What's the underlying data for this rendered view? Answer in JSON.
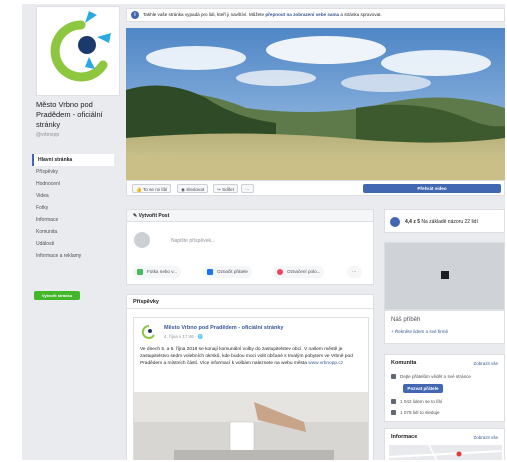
{
  "notice": {
    "text": "Takhle vaše stránka vypadá pro lidi, kteří ji navštíví. Můžete",
    "link": "přepnout na zobrazení sebe sama",
    "text_after": "a stránku spravovat.",
    "icon": "info-icon"
  },
  "sidebar": {
    "page_name": "Město Vrbno pod Pradědem - oficiální stránky",
    "handle": "@vrbnopp",
    "items": [
      {
        "label": "Hlavní stránka",
        "active": true
      },
      {
        "label": "Příspěvky"
      },
      {
        "label": "Hodnocení"
      },
      {
        "label": "Videa"
      },
      {
        "label": "Fotky"
      },
      {
        "label": "Informace"
      },
      {
        "label": "Komunita"
      },
      {
        "label": "Události"
      },
      {
        "label": "Informace a reklamy"
      }
    ],
    "create_button": "Vytvořit stránku"
  },
  "actions": {
    "like": "To se mi líbí",
    "follow": "Sledovat",
    "share": "Sdílet",
    "more": "···",
    "video": "Přehrát video"
  },
  "create_post": {
    "title": "Vytvořit Post",
    "placeholder": "Napište příspěvek...",
    "options": [
      {
        "label": "Fotka nebo v...",
        "color": "#45bd62"
      },
      {
        "label": "Označit přátele",
        "color": "#1877f2"
      },
      {
        "label": "Označení polo...",
        "color": "#f3425f"
      }
    ],
    "more": "···"
  },
  "posts": {
    "title": "Příspěvky",
    "author": "Město Vrbno pod Pradědem - oficiální stránky",
    "time": "4. října v 17:46 · 🌐",
    "body": "Ve dnech 5. a 6. října 2018 se konají komunální volby do zastupitelstev obcí. V našem městě je zastupitelstvo sedm volebních okrsků, kde budou moci volit občané s trvalým pobytem ve Vrbně pod Pradědem a místních částí. Více informací k volbám naleznete na webu města",
    "link": "www.vrbnopp.cz"
  },
  "rating": {
    "score": "4,4 z 5",
    "text": "Na základě názoru 22 lidí"
  },
  "map_place": {
    "title": "Náš příběh",
    "link": "+ Řekněte lidem o své firmě"
  },
  "community": {
    "title": "Komunita",
    "see_all": "Zobrazit vše",
    "invite_text": "Dejte přátelům vědět o své stránce",
    "invite_button": "Pozvat přátele",
    "likes": "1 042 lidem se to líbí",
    "follows": "1 078 lidí to sleduje"
  },
  "info": {
    "title": "Informace",
    "see_all": "Zobrazit vše"
  },
  "colors": {
    "brand": "#4267b2",
    "green": "#42b72a",
    "logo_cyan": "#29abe2",
    "logo_green": "#8dc63f",
    "logo_navy": "#1b3a6b"
  }
}
